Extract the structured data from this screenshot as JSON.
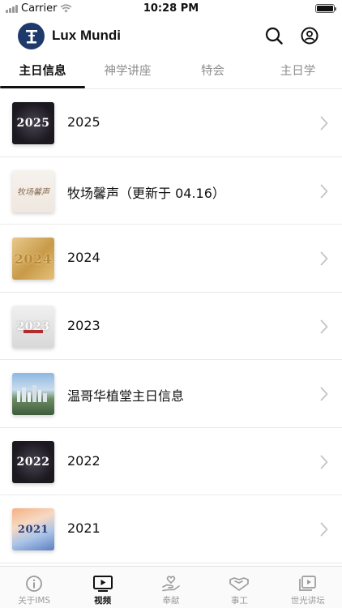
{
  "status": {
    "carrier": "Carrier",
    "time": "10:28 PM"
  },
  "header": {
    "title": "Lux Mundi",
    "logo_icon": "lux-mundi-logo",
    "search_icon": "search-icon",
    "profile_icon": "user-circle-icon"
  },
  "tabs": [
    {
      "label": "主日信息",
      "active": true
    },
    {
      "label": "神学讲座",
      "active": false
    },
    {
      "label": "特会",
      "active": false
    },
    {
      "label": "主日学",
      "active": false
    }
  ],
  "list": [
    {
      "title": "2025",
      "thumb_text": "2025"
    },
    {
      "title": "牧场馨声（更新于 04.16）",
      "thumb_text": "牧场馨声"
    },
    {
      "title": "2024",
      "thumb_text": "2024"
    },
    {
      "title": "2023",
      "thumb_text": "2023"
    },
    {
      "title": "温哥华植堂主日信息",
      "thumb_text": ""
    },
    {
      "title": "2022",
      "thumb_text": "2022"
    },
    {
      "title": "2021",
      "thumb_text": "2021"
    }
  ],
  "tab_bar": [
    {
      "label": "关于IMS",
      "icon": "info-icon",
      "active": false
    },
    {
      "label": "视频",
      "icon": "video-icon",
      "active": true
    },
    {
      "label": "奉献",
      "icon": "donate-hand-icon",
      "active": false
    },
    {
      "label": "事工",
      "icon": "handshake-icon",
      "active": false
    },
    {
      "label": "世光讲坛",
      "icon": "playlist-icon",
      "active": false
    }
  ],
  "colors": {
    "brand": "#1d3a6b",
    "active_text": "#111111",
    "inactive_text": "#8e8e8e"
  }
}
